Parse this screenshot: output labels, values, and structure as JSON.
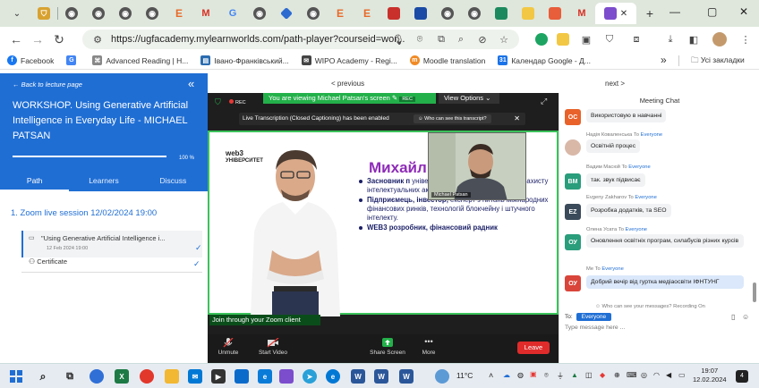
{
  "browser": {
    "tabs": [
      {
        "icon": "chevron-down-icon"
      },
      {
        "icon": "shield-favicon"
      },
      {
        "icon": "globe-favicon"
      },
      {
        "icon": "globe-favicon"
      },
      {
        "icon": "globe-favicon"
      },
      {
        "icon": "globe-favicon"
      },
      {
        "icon": "e-favicon",
        "letter": "E"
      },
      {
        "icon": "gmail-favicon",
        "letter": "M"
      },
      {
        "icon": "google-favicon",
        "letter": "G"
      },
      {
        "icon": "globe-favicon"
      },
      {
        "icon": "diamond-favicon"
      },
      {
        "icon": "globe-favicon"
      },
      {
        "icon": "e-favicon",
        "letter": "E"
      },
      {
        "icon": "e-favicon",
        "letter": "E"
      }
    ],
    "new_tab": "+",
    "url": "https://ugfacademy.mylearnworlds.com/path-player?courseid=wor...",
    "bookmarks": [
      {
        "label": "Facebook",
        "color": "#1877f2",
        "letter": "f"
      },
      {
        "label": "",
        "color": "#4285f4",
        "letter": "G"
      },
      {
        "label": "Advanced Reading | H...",
        "color": "#888888",
        "letter": "⌘"
      },
      {
        "label": "Івано-Франківський...",
        "color": "#2b6cb0",
        "letter": "▤"
      },
      {
        "label": "WIPO Academy - Regi...",
        "color": "#444444",
        "letter": "✉"
      },
      {
        "label": "Moodle translation",
        "color": "#f08a24",
        "letter": "m"
      },
      {
        "label": "Календар Google - Д...",
        "color": "#1a73e8",
        "letter": "31"
      }
    ],
    "bookmarks_more": "»",
    "all_bookmarks": "Усі закладки"
  },
  "course": {
    "back_label": "Back to lecture page",
    "title": "WORKSHOP. Using Generative Artificial Intelligence in Everyday Life - MICHAEL PATSAN",
    "progress_label": "100 %",
    "progress": 1.0,
    "tabs": [
      "Path",
      "Learners",
      "Discuss"
    ],
    "section": "1. Zoom live session 12/02/2024 19:00",
    "lesson_title": "\"Using Generative Artificial Intelligence i...",
    "lesson_date": "12 Feb 2024 19:00",
    "certificate": "Certificate"
  },
  "nav": {
    "prev": "< previous",
    "next": "next >"
  },
  "zoom": {
    "share_banner": "You are viewing Michael Patsan's screen",
    "rec_small": "REC",
    "view_options": "View Options",
    "rec": "REC",
    "caption": "Live Transcription (Closed Captioning) has been enabled",
    "who_can_see": "Who can see this transcript?",
    "slide": {
      "logo_top": "web3",
      "logo_bottom": "УНІВЕРСИТЕТ",
      "name": "Михайл",
      "bullets": [
        {
          "bold": "Засновник п",
          "text": " університету, блокчейн-протоколу захисту інтелектуальних активів Amsets."
        },
        {
          "bold": "Підприємець, інвестор,",
          "text": " експерт з питань міжнародних фінансових ринків, технологій блокчейну і штучного інтелекту."
        },
        {
          "bold": "WEB3 розробник, фінансовий радник",
          "text": ""
        }
      ]
    },
    "camera_name": "Michael Patsan",
    "join_link": "Join through your Zoom client",
    "controls": {
      "unmute": "Unmute",
      "start_video": "Start Video",
      "share_screen": "Share Screen",
      "more": "More",
      "leave": "Leave"
    }
  },
  "chat": {
    "title": "Meeting Chat",
    "messages": [
      {
        "sender": "",
        "to": "",
        "initials": "OC",
        "color": "#e8622a",
        "text": "Використовую в навчанні"
      },
      {
        "sender": "Надія Коваленська",
        "to": "Everyone",
        "initials": "",
        "color": "#b85b6a",
        "text": "Освітній процес"
      },
      {
        "sender": "Вадим Масюй",
        "to": "Everyone",
        "initials": "ВМ",
        "color": "#2a9d7b",
        "text": "так. звук підвисає"
      },
      {
        "sender": "Evgeny Zakharov",
        "to": "Everyone",
        "initials": "EZ",
        "color": "#3a4a5a",
        "text": "Розробка додатків, та SEO"
      },
      {
        "sender": "Олена Усата",
        "to": "Everyone",
        "initials": "ОУ",
        "color": "#2a9d7b",
        "text": "Оновлення освітніх програм, силабусів різних курсів"
      },
      {
        "sender": "Me",
        "to": "Everyone",
        "initials": "ОУ",
        "color": "#d9453a",
        "text": "Добрий вечір від гуртка медіаосвіти ІФНТУНГ"
      }
    ],
    "to_word": "To",
    "who_can_see": "Who can see your messages? Recording On",
    "to_label": "To:",
    "to_value": "Everyone",
    "input_placeholder": "Type message here ..."
  },
  "taskbar": {
    "weather": "11°C",
    "time": "19:07",
    "date": "12.02.2024",
    "notifications": "4"
  }
}
